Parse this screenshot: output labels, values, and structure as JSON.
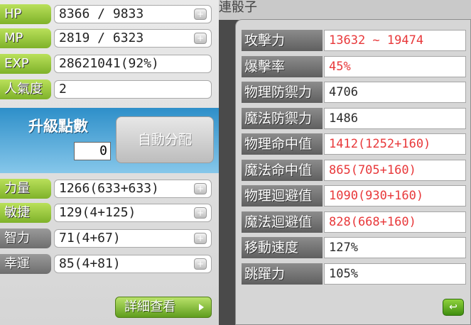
{
  "basic": [
    {
      "label": "HP",
      "value": "8366 / 9833",
      "style": "green"
    },
    {
      "label": "MP",
      "value": "2819 / 6323",
      "style": "green"
    },
    {
      "label": "EXP",
      "value": "28621041(92%)",
      "style": "green"
    },
    {
      "label": "人氣度",
      "value": "2",
      "style": "green"
    }
  ],
  "ap": {
    "title": "升級點數",
    "value": "0",
    "auto_button": "自動分配"
  },
  "stats": [
    {
      "label": "力量",
      "value": "1266(633+633)",
      "style": "green"
    },
    {
      "label": "敏捷",
      "value": "129(4+125)",
      "style": "green"
    },
    {
      "label": "智力",
      "value": "71(4+67)",
      "style": "grey"
    },
    {
      "label": "幸運",
      "value": "85(4+81)",
      "style": "grey"
    }
  ],
  "detail_button": "詳細查看",
  "header_fragment": "連骰子",
  "details": [
    {
      "label": "攻擊力",
      "value": "13632 ~ 19474",
      "highlight": true
    },
    {
      "label": "爆擊率",
      "value": "45%",
      "highlight": true
    },
    {
      "label": "物理防禦力",
      "value": "4706",
      "highlight": false
    },
    {
      "label": "魔法防禦力",
      "value": "1486",
      "highlight": false
    },
    {
      "label": "物理命中值",
      "value": "1412(1252+160)",
      "highlight": true
    },
    {
      "label": "魔法命中值",
      "value": "865(705+160)",
      "highlight": true
    },
    {
      "label": "物理迴避值",
      "value": "1090(930+160)",
      "highlight": true
    },
    {
      "label": "魔法迴避值",
      "value": "828(668+160)",
      "highlight": true
    },
    {
      "label": "移動速度",
      "value": "127%",
      "highlight": false
    },
    {
      "label": "跳躍力",
      "value": "105%",
      "highlight": false
    }
  ],
  "colors": {
    "accent_green": "#8cc43a",
    "highlight_red": "#e8383a",
    "ap_blue": "#2e8fc9"
  }
}
